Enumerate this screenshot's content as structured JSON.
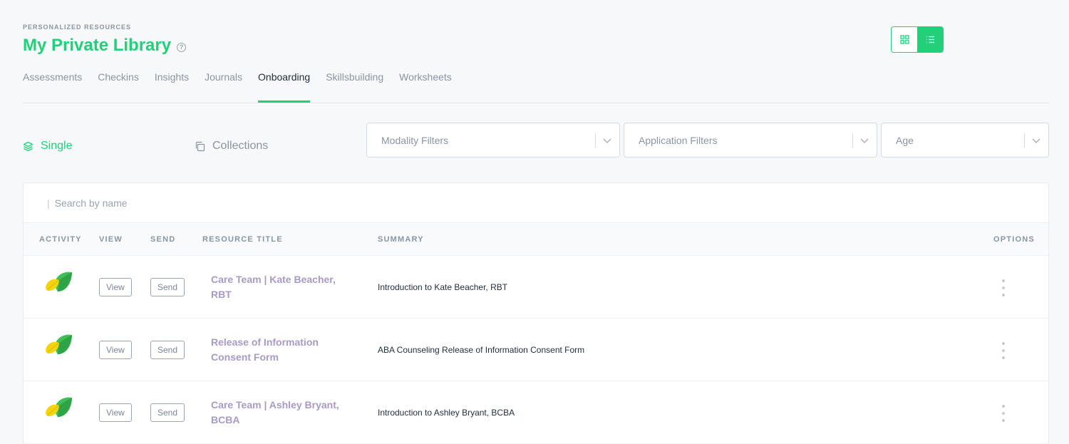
{
  "header": {
    "eyebrow": "PERSONALIZED RESOURCES",
    "title": "My Private Library",
    "help_glyph": "?"
  },
  "view_toggle": {
    "grid_icon": "grid-icon",
    "list_icon": "list-icon",
    "active": "list"
  },
  "tabs": [
    {
      "label": "Assessments",
      "active": false
    },
    {
      "label": "Checkins",
      "active": false
    },
    {
      "label": "Insights",
      "active": false
    },
    {
      "label": "Journals",
      "active": false
    },
    {
      "label": "Onboarding",
      "active": true
    },
    {
      "label": "Skillsbuilding",
      "active": false
    },
    {
      "label": "Worksheets",
      "active": false
    }
  ],
  "modes": {
    "single": {
      "label": "Single",
      "icon": "layers-icon",
      "active": true
    },
    "collections": {
      "label": "Collections",
      "icon": "copy-icon",
      "active": false
    }
  },
  "filters": {
    "modality": "Modality Filters",
    "application": "Application Filters",
    "age": "Age"
  },
  "search": {
    "placeholder": "Search by name",
    "caret": "|"
  },
  "table": {
    "headers": {
      "activity": "ACTIVITY",
      "view": "VIEW",
      "send": "SEND",
      "title": "RESOURCE TITLE",
      "summary": "SUMMARY",
      "options": "OPTIONS"
    },
    "rows": [
      {
        "activity_icon": "leaf-icon",
        "view": "View",
        "send": "Send",
        "title": "Care Team | Kate Beacher, RBT",
        "summary": "Introduction to Kate Beacher, RBT"
      },
      {
        "activity_icon": "leaf-icon",
        "view": "View",
        "send": "Send",
        "title": "Release of Information Consent Form",
        "summary": "ABA Counseling Release of Information Consent Form"
      },
      {
        "activity_icon": "leaf-icon",
        "view": "View",
        "send": "Send",
        "title": "Care Team | Ashley Bryant, BCBA",
        "summary": "Introduction to Ashley Bryant, BCBA"
      }
    ]
  },
  "colors": {
    "accent": "#22d07a",
    "title_link": "#a79bc6",
    "muted": "#8a95a3"
  }
}
